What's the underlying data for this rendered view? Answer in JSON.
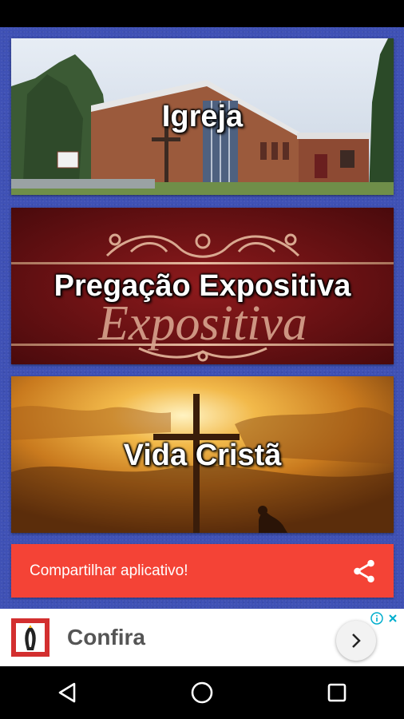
{
  "cards": [
    {
      "label": "Igreja"
    },
    {
      "label": "Pregação Expositiva",
      "overlay_script": "Expositiva"
    },
    {
      "label": "Vida Cristã"
    }
  ],
  "share": {
    "label": "Compartilhar aplicativo!",
    "icon": "share-icon",
    "color": "#f44336"
  },
  "ad": {
    "title": "Confira",
    "logo_icon": "ad-brand-logo-icon",
    "info_icon": "ad-info-icon",
    "close_icon": "ad-close-icon",
    "action_icon": "chevron-right-icon"
  },
  "nav": {
    "back_icon": "back-triangle-icon",
    "home_icon": "home-circle-icon",
    "recents_icon": "recents-square-icon"
  },
  "colors": {
    "app_background": "#3f51b5",
    "share_bar": "#f44336"
  }
}
